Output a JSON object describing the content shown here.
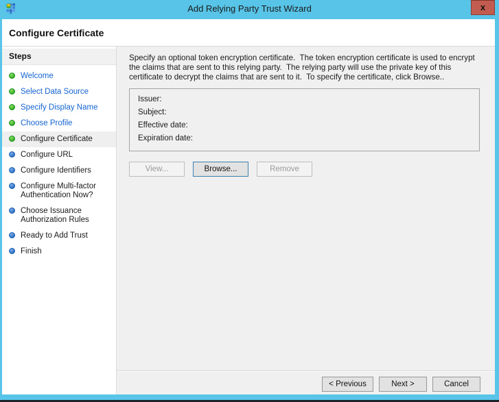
{
  "window": {
    "title": "Add Relying Party Trust Wizard",
    "close_glyph": "x"
  },
  "header": {
    "title": "Configure Certificate"
  },
  "sidebar": {
    "title": "Steps",
    "items": [
      {
        "label": "Welcome",
        "state": "completed"
      },
      {
        "label": "Select Data Source",
        "state": "completed"
      },
      {
        "label": "Specify Display Name",
        "state": "completed"
      },
      {
        "label": "Choose Profile",
        "state": "completed"
      },
      {
        "label": "Configure Certificate",
        "state": "current"
      },
      {
        "label": "Configure URL",
        "state": "upcoming"
      },
      {
        "label": "Configure Identifiers",
        "state": "upcoming"
      },
      {
        "label": "Configure Multi-factor Authentication Now?",
        "state": "upcoming"
      },
      {
        "label": "Choose Issuance Authorization Rules",
        "state": "upcoming"
      },
      {
        "label": "Ready to Add Trust",
        "state": "upcoming"
      },
      {
        "label": "Finish",
        "state": "upcoming"
      }
    ]
  },
  "main": {
    "instruction": "Specify an optional token encryption certificate.  The token encryption certificate is used to encrypt the claims that are sent to this relying party.  The relying party will use the private key of this certificate to decrypt the claims that are sent to it.  To specify the certificate, click Browse..",
    "certificate_fields": [
      {
        "label": "Issuer:",
        "value": ""
      },
      {
        "label": "Subject:",
        "value": ""
      },
      {
        "label": "Effective date:",
        "value": ""
      },
      {
        "label": "Expiration date:",
        "value": ""
      }
    ],
    "buttons": [
      {
        "label": "View...",
        "enabled": false
      },
      {
        "label": "Browse...",
        "enabled": true,
        "default": true
      },
      {
        "label": "Remove",
        "enabled": false
      }
    ]
  },
  "footer": {
    "buttons": [
      {
        "label": "< Previous"
      },
      {
        "label": "Next >"
      },
      {
        "label": "Cancel"
      }
    ]
  },
  "colors": {
    "titlebar_blue": "#57C4E8",
    "close_button_red": "#C25B50",
    "link_blue": "#1464D2",
    "bullet_green": "#2FAE24",
    "bullet_blue": "#2A6FC8",
    "panel_gray": "#F0F0F0",
    "default_button_border_blue": "#3C7FB1"
  }
}
